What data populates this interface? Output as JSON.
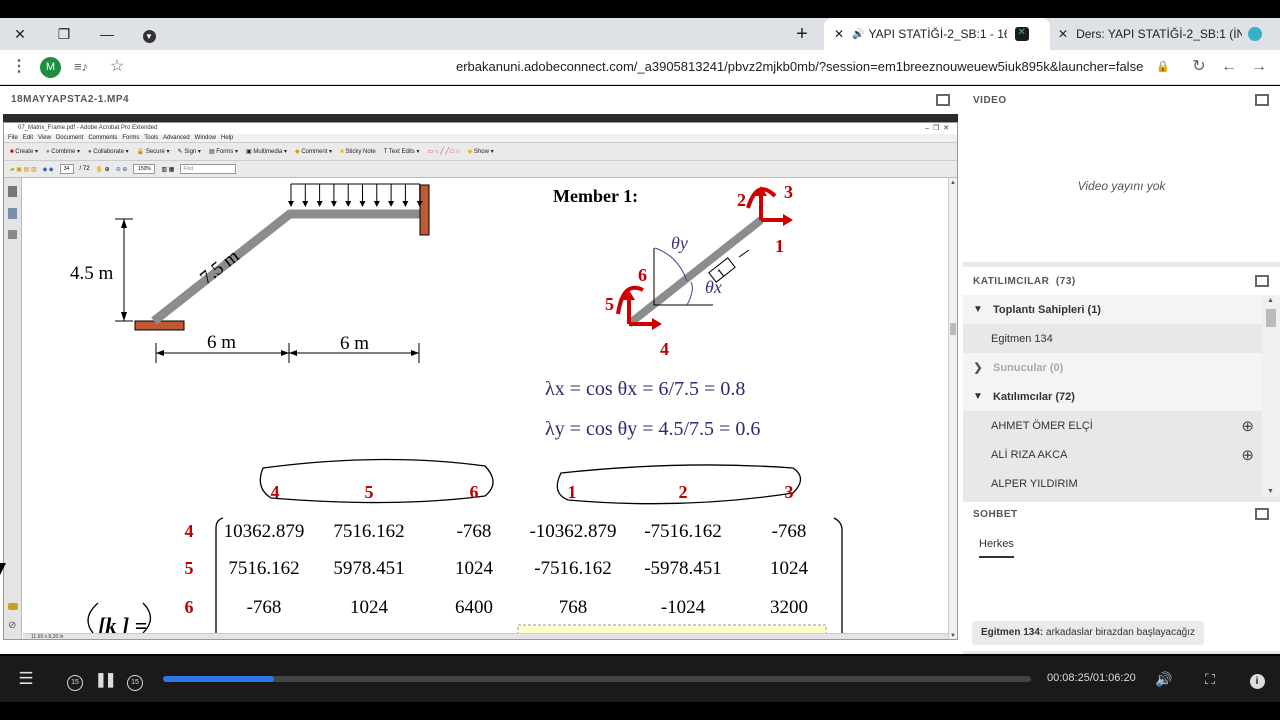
{
  "browser": {
    "tabs": [
      {
        "title": "YAPI STATİĞİ-2_SB:1 - 16902",
        "active": true
      },
      {
        "title": "Ders: YAPI STATİĞİ-2_SB:1 (İNŞAA",
        "active": false
      }
    ],
    "profile_initial": "M",
    "url": "erbakanuni.adobeconnect.com/_a3905813241/pbvz2mjkb0mb/?session=em1breeznouweuew5iuk895k&launcher=false"
  },
  "share_pod": {
    "title": "18MAYYAPSTA2-1.MP4"
  },
  "acrobat": {
    "window_title": "07_Matrix_Frame.pdf - Adobe Acrobat Pro Extended",
    "menu": [
      "File",
      "Edit",
      "View",
      "Document",
      "Comments",
      "Forms",
      "Tools",
      "Advanced",
      "Window",
      "Help"
    ],
    "toolbar": [
      "Create",
      "Combine",
      "Collaborate",
      "Secure",
      "Sign",
      "Forms",
      "Multimedia",
      "Comment",
      "Sticky Note",
      "Text Edits",
      "Show"
    ],
    "page_num": "34",
    "page_total": "/ 72",
    "zoom": "150%",
    "find_placeholder": "Find",
    "page_size": "11.69 x 8.26 in"
  },
  "figure": {
    "height_label": "4.5 m",
    "length_label": "7.5 m",
    "span1": "6 m",
    "span2": "6 m",
    "member_title": "Member 1:",
    "dof_labels": [
      "1",
      "2",
      "3",
      "4",
      "5",
      "6"
    ],
    "theta_x": "θx",
    "theta_y": "θy",
    "member_id": "1"
  },
  "equations": {
    "lambda_x": "λx = cos θx = 6/7.5 = 0.8",
    "lambda_y": "λy = cos θy = 4.5/7.5 = 0.6"
  },
  "matrix": {
    "col_headers": [
      "4",
      "5",
      "6",
      "1",
      "2",
      "3"
    ],
    "row_headers": [
      "4",
      "5",
      "6"
    ],
    "rows": [
      [
        "10362.879",
        "7516.162",
        "-768",
        "-10362.879",
        "-7516.162",
        "-768"
      ],
      [
        "7516.162",
        "5978.451",
        "1024",
        "-7516.162",
        "-5978.451",
        "1024"
      ],
      [
        "-768",
        "1024",
        "6400",
        "768",
        "-1024",
        "3200"
      ]
    ],
    "k_label": "[k ] ="
  },
  "video_pod": {
    "title": "VIDEO",
    "empty_text": "Video yayını yok"
  },
  "attendees_pod": {
    "title": "KATILIMCILAR",
    "count": "(73)",
    "groups": [
      {
        "label": "Toplantı Sahipleri (1)",
        "expanded": true,
        "members": [
          "Egitmen 134"
        ]
      },
      {
        "label": "Sunucular (0)",
        "expanded": false,
        "members": []
      },
      {
        "label": "Katılımcılar (72)",
        "expanded": true,
        "members": [
          "AHMET ÖMER ELÇİ",
          "ALİ RIZA AKCA",
          "ALPER YILDIRIM"
        ]
      }
    ]
  },
  "chat_pod": {
    "title": "SOHBET",
    "tab": "Herkes",
    "message_sender": "Egitmen 134:",
    "message_text": "arkadaslar  birazdan başlayacağız"
  },
  "player": {
    "time": "00:08:25/01:06:20",
    "progress": 0.128,
    "skip_back": "15",
    "skip_fwd": "15"
  }
}
